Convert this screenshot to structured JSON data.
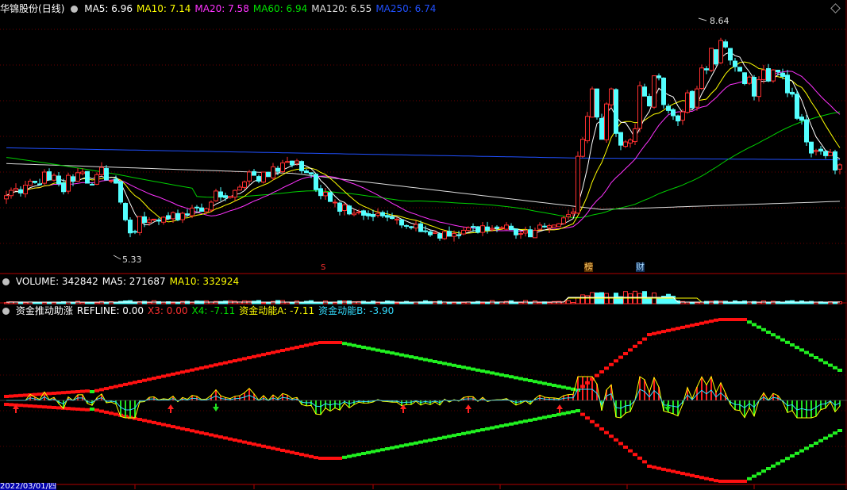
{
  "stock_name": "华锦股份",
  "period": "(日线)",
  "price_legend": [
    {
      "label": "MA5: 6.96",
      "color": "#ffffff"
    },
    {
      "label": "MA10: 7.14",
      "color": "#ffff00"
    },
    {
      "label": "MA20: 7.58",
      "color": "#ff33ff"
    },
    {
      "label": "MA60: 6.94",
      "color": "#00e000"
    },
    {
      "label": "MA120: 6.55",
      "color": "#dddddd"
    },
    {
      "label": "MA250: 6.74",
      "color": "#2050ff"
    }
  ],
  "volume_legend": [
    {
      "label": "VOLUME: 342842",
      "color": "#ffffff"
    },
    {
      "label": "MA5: 271687",
      "color": "#ffffff"
    },
    {
      "label": "MA10: 332924",
      "color": "#ffff00"
    }
  ],
  "indicator_legend": [
    {
      "label": "资金推动助涨",
      "color": "#ffffff"
    },
    {
      "label": "REFLINE: 0.00",
      "color": "#ffffff"
    },
    {
      "label": "X3: 0.00",
      "color": "#ff3030"
    },
    {
      "label": "X4: -7.11",
      "color": "#00e000"
    },
    {
      "label": "资金动能A: -7.11",
      "color": "#ffff00"
    },
    {
      "label": "资金动能B: -3.90",
      "color": "#33ddff"
    }
  ],
  "annotations": {
    "high_price": "8.64",
    "low_price": "5.33",
    "marker_s": "S",
    "marker_bang": "榜",
    "marker_cai": "财",
    "date_label": "2022/03/01/四"
  },
  "chart_data": [
    {
      "type": "candlestick",
      "title": "华锦股份(日线)",
      "ylim": [
        5.0,
        8.9
      ],
      "grid": true,
      "high_label": 8.64,
      "low_label": 5.33,
      "close": [
        6.13,
        6.21,
        6.24,
        6.17,
        6.29,
        6.35,
        6.33,
        6.3,
        6.49,
        6.37,
        6.44,
        6.31,
        6.19,
        6.44,
        6.35,
        6.48,
        6.49,
        6.32,
        6.3,
        6.45,
        6.56,
        6.37,
        6.36,
        6.32,
        6.03,
        5.76,
        5.56,
        5.58,
        5.81,
        5.72,
        5.76,
        5.77,
        5.74,
        5.8,
        5.78,
        5.87,
        5.76,
        5.86,
        5.84,
        5.94,
        5.95,
        5.89,
        5.93,
        6.03,
        6.2,
        6.11,
        6.1,
        6.12,
        6.21,
        6.26,
        6.34,
        6.49,
        6.44,
        6.35,
        6.49,
        6.42,
        6.57,
        6.5,
        6.63,
        6.65,
        6.6,
        6.66,
        6.51,
        6.48,
        6.46,
        6.22,
        6.13,
        6.18,
        6.04,
        6.03,
        5.89,
        5.99,
        5.85,
        5.86,
        5.88,
        5.83,
        5.82,
        5.81,
        5.86,
        5.82,
        5.8,
        5.78,
        5.77,
        5.68,
        5.67,
        5.64,
        5.69,
        5.58,
        5.59,
        5.53,
        5.57,
        5.48,
        5.58,
        5.51,
        5.55,
        5.52,
        5.6,
        5.64,
        5.65,
        5.57,
        5.67,
        5.6,
        5.63,
        5.64,
        5.64,
        5.68,
        5.61,
        5.53,
        5.55,
        5.59,
        5.5,
        5.6,
        5.68,
        5.66,
        5.67,
        5.68,
        5.7,
        5.79,
        5.84,
        5.88,
        6.73,
        6.99,
        7.34,
        7.76,
        7.33,
        6.99,
        7.53,
        7.76,
        7.08,
        6.9,
        6.95,
        6.98,
        7.15,
        7.81,
        7.65,
        7.5,
        7.96,
        7.93,
        7.52,
        7.43,
        7.35,
        7.27,
        7.41,
        7.7,
        7.47,
        7.76,
        8.08,
        8.05,
        8.38,
        8.14,
        8.5,
        8.4,
        8.2,
        8.1,
        8.03,
        7.84,
        7.94,
        7.65,
        7.9,
        8.05,
        7.88,
        8.05,
        8.02,
        7.95,
        7.7,
        7.68,
        7.31,
        7.28,
        6.95,
        6.78,
        6.82,
        6.81,
        6.74,
        6.79,
        6.52,
        6.6
      ],
      "ma5_last": 6.96,
      "ma10_last": 7.14,
      "ma20_last": 7.58,
      "ma60_last": 6.94,
      "ma120_last": 6.55,
      "ma250_last": 6.74
    },
    {
      "type": "bar",
      "title": "VOLUME",
      "last_volume": 342842,
      "ma5": 271687,
      "ma10": 332924
    },
    {
      "type": "line",
      "title": "资金推动助涨",
      "refline": 0.0,
      "x3": 0.0,
      "x4": -7.11,
      "fund_a": -7.11,
      "fund_b": -3.9
    }
  ]
}
